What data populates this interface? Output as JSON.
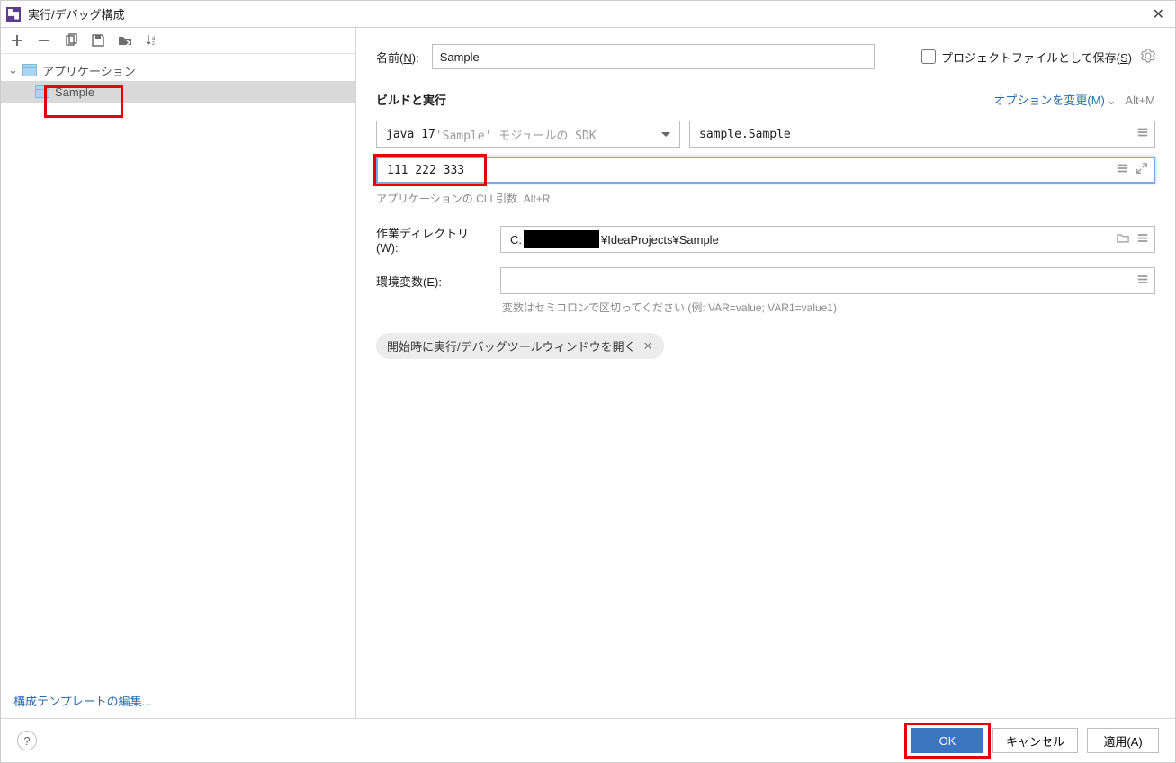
{
  "title": "実行/デバッグ構成",
  "sidebar": {
    "tree": {
      "application_label": "アプリケーション",
      "sample_label": "Sample"
    },
    "edit_templates": "構成テンプレートの編集..."
  },
  "main": {
    "name_label_prefix": "名前(",
    "name_label_key": "N",
    "name_label_suffix": "):",
    "name_value": "Sample",
    "save_project_prefix": "プロジェクトファイルとして保存(",
    "save_project_key": "S",
    "save_project_suffix": ")",
    "build_title": "ビルドと実行",
    "modify_options_prefix": "オプションを変更(",
    "modify_options_key": "M",
    "modify_options_suffix": ")",
    "modify_shortcut": "Alt+M",
    "jdk_value": "java 17",
    "jdk_hint": " 'Sample' モジュールの SDK",
    "main_class": "sample.Sample",
    "args_value": "111 222 333",
    "args_hint": "アプリケーションの CLI 引数. Alt+R",
    "workdir_label_prefix": "作業ディレクトリ(",
    "workdir_label_key": "W",
    "workdir_label_suffix": "):",
    "workdir_prefix": "C:",
    "workdir_suffix": "¥IdeaProjects¥Sample",
    "env_label_prefix": "環境変数(",
    "env_label_key": "E",
    "env_label_suffix": "):",
    "env_hint": "変数はセミコロンで区切ってください (例: VAR=value; VAR1=value1)",
    "chip_label": "開始時に実行/デバッグツールウィンドウを開く"
  },
  "footer": {
    "help": "?",
    "ok": "OK",
    "cancel": "キャンセル",
    "apply_prefix": "適用(",
    "apply_key": "A",
    "apply_suffix": ")"
  }
}
